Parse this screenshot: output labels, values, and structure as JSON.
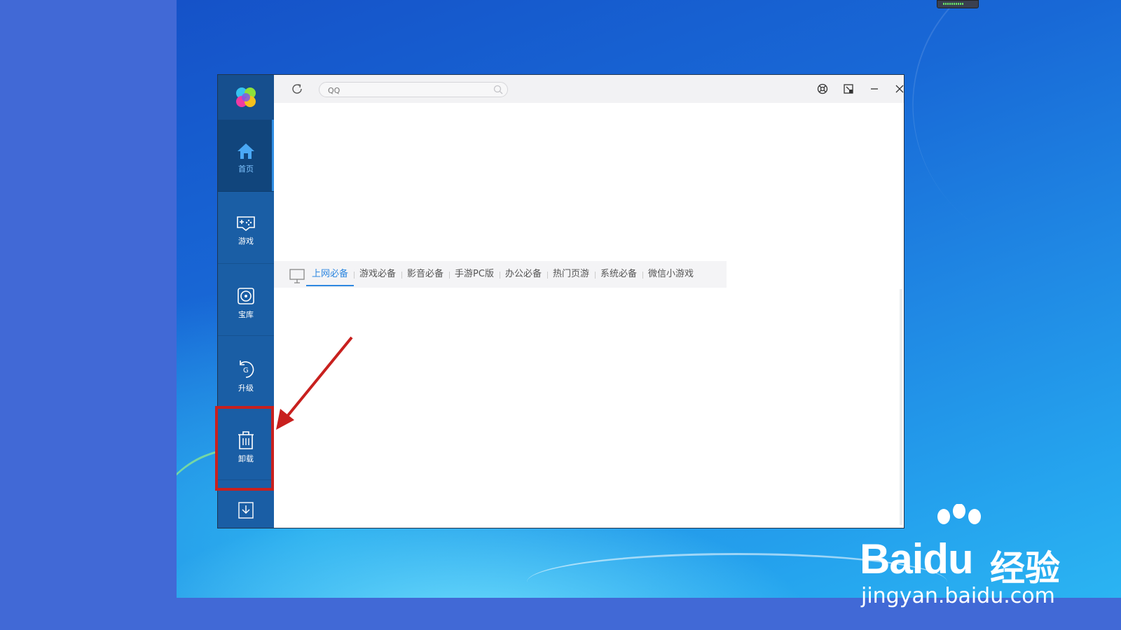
{
  "app": {
    "search": {
      "placeholder": "QQ"
    },
    "sidebar": {
      "items": [
        {
          "label": "首页",
          "icon": "home-icon",
          "active": true
        },
        {
          "label": "游戏",
          "icon": "gamepad-icon",
          "active": false
        },
        {
          "label": "宝库",
          "icon": "disc-icon",
          "active": false
        },
        {
          "label": "升级",
          "icon": "upgrade-icon",
          "active": false
        },
        {
          "label": "卸载",
          "icon": "trash-icon",
          "active": false,
          "highlighted": true
        }
      ],
      "bottom_icon": "download-icon"
    },
    "window_controls": [
      "settings-icon",
      "mini-mode-icon",
      "minimize-icon",
      "close-icon"
    ],
    "tabs": [
      {
        "label": "上网必备",
        "active": true
      },
      {
        "label": "游戏必备"
      },
      {
        "label": "影音必备"
      },
      {
        "label": "手游PC版"
      },
      {
        "label": "办公必备"
      },
      {
        "label": "热门页游"
      },
      {
        "label": "系统必备"
      },
      {
        "label": "微信小游戏"
      }
    ]
  },
  "annotation": {
    "highlight_color": "#c8201e"
  },
  "watermark": {
    "brand": "Bai",
    "brand2": "du",
    "cn": "经验",
    "url": "jingyan.baidu.com"
  },
  "colors": {
    "sidebar": "#1a5ea5",
    "accent": "#2e87e0",
    "desktop_bg": "#4169d6"
  }
}
